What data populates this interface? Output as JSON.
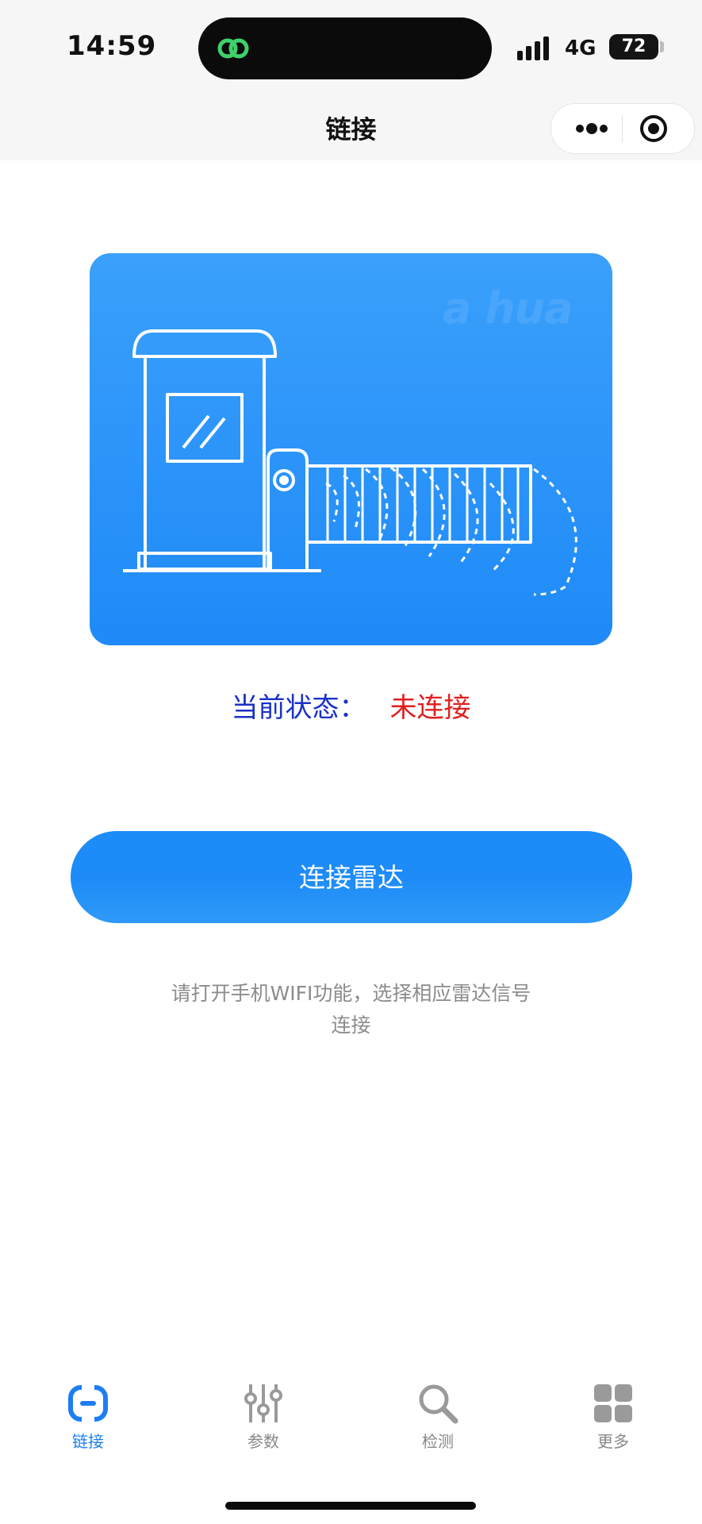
{
  "status_bar": {
    "time": "14:59",
    "network": "4G",
    "battery": "72",
    "island_icon": "wechat-mini-program-icon"
  },
  "nav": {
    "title": "链接",
    "more_icon": "more-dots-icon",
    "close_icon": "target-close-icon"
  },
  "hero": {
    "brand": "a hua",
    "illustration": "parking-barrier-radar-illustration"
  },
  "status": {
    "label": "当前状态：",
    "value": "未连接"
  },
  "connect_button": {
    "label": "连接雷达"
  },
  "hint": {
    "text": "请打开手机WIFI功能，选择相应雷达信号连接"
  },
  "tabbar": {
    "items": [
      {
        "label": "链接",
        "icon": "link-icon",
        "active": true
      },
      {
        "label": "参数",
        "icon": "sliders-icon",
        "active": false
      },
      {
        "label": "检测",
        "icon": "search-icon",
        "active": false
      },
      {
        "label": "更多",
        "icon": "grid-icon",
        "active": false
      }
    ]
  },
  "colors": {
    "accent": "#1d8bf8",
    "status_label": "#1a32c8",
    "status_value": "#e11f1f",
    "tab_active": "#1d7ef2",
    "tab_inactive": "#888888"
  }
}
